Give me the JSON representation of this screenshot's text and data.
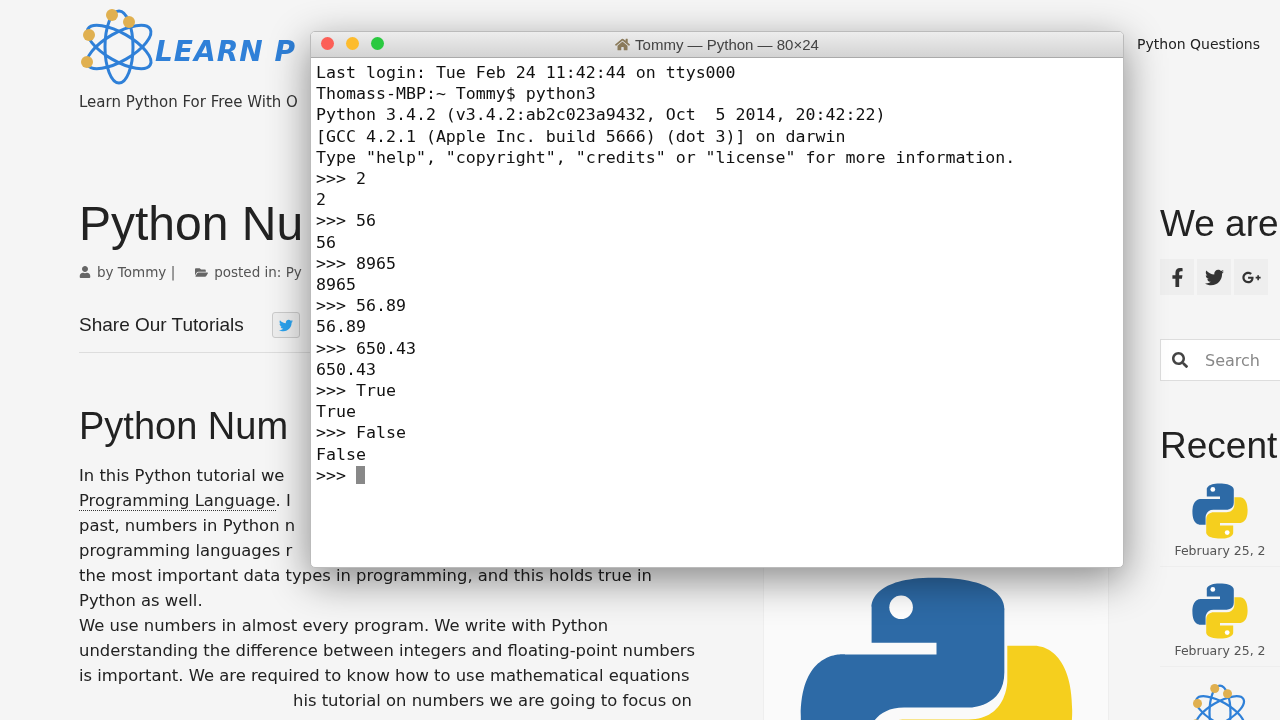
{
  "site": {
    "logo_text": "LEARN P",
    "tagline": "Learn Python For Free With O",
    "nav": [
      "Python Questions"
    ]
  },
  "article": {
    "title": "Python Nu",
    "author": "by Tommy |",
    "posted_in": "posted in: Py",
    "share_label": "Share Our Tutorials",
    "heading": "Python Num",
    "lines": [
      {
        "text": "In this Python tutorial we"
      },
      {
        "link": "Programming Language",
        "text": ". I"
      },
      {
        "text": "past, numbers in Python n"
      },
      {
        "text": "programming languages r"
      },
      {
        "text": "the most important data types in programming, and this holds true in"
      },
      {
        "text": "Python as well."
      },
      {
        "text": "We use numbers in almost every program. We write with Python"
      },
      {
        "text": "understanding the difference between integers and floating-point numbers"
      },
      {
        "text": "is important. We are required to know how to use mathematical equations"
      },
      {
        "text": "his tutorial on numbers we are going to focus on",
        "indent": true
      }
    ]
  },
  "sidebar": {
    "heading": "We are",
    "social": [
      {
        "kind": "facebook"
      },
      {
        "kind": "twitter"
      },
      {
        "kind": "google-plus"
      }
    ],
    "search": {
      "placeholder": "Search"
    },
    "recent_heading": "Recent",
    "recent": [
      {
        "kind": "snake",
        "date": "February 25, 2"
      },
      {
        "kind": "snake",
        "date": "February 25, 2"
      },
      {
        "kind": "atom"
      }
    ]
  },
  "terminal": {
    "title": "Tommy — Python — 80×24",
    "lines": [
      "Last login: Tue Feb 24 11:42:44 on ttys000",
      "Thomass-MBP:~ Tommy$ python3",
      "Python 3.4.2 (v3.4.2:ab2c023a9432, Oct  5 2014, 20:42:22)",
      "[GCC 4.2.1 (Apple Inc. build 5666) (dot 3)] on darwin",
      "Type \"help\", \"copyright\", \"credits\" or \"license\" for more information.",
      ">>> 2",
      "2",
      ">>> 56",
      "56",
      ">>> 8965",
      "8965",
      ">>> 56.89",
      "56.89",
      ">>> 650.43",
      "650.43",
      ">>> True",
      "True",
      ">>> False",
      "False",
      ">>>"
    ]
  }
}
